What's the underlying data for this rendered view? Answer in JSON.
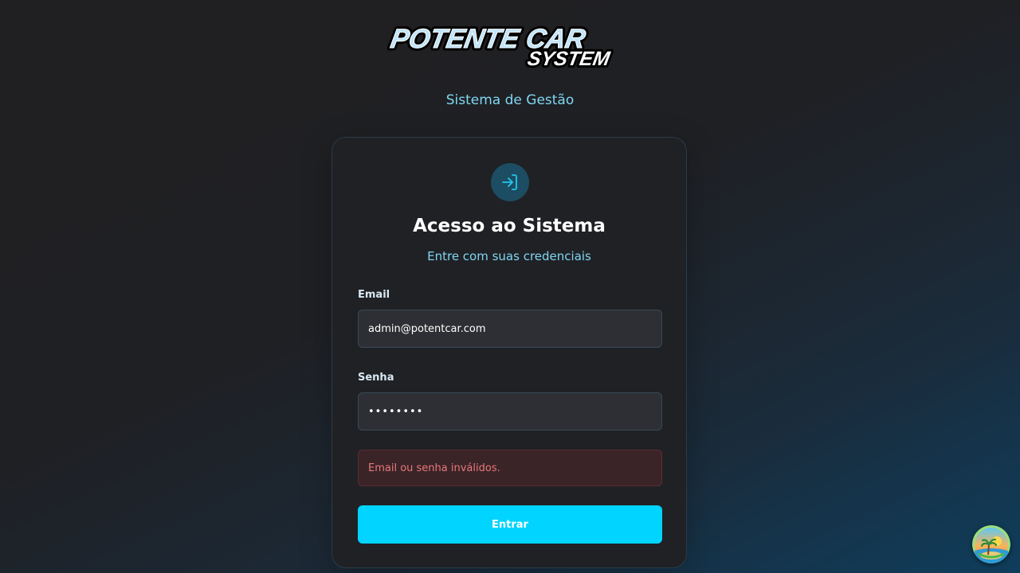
{
  "header": {
    "logo_line1": "POTENTE CAR",
    "logo_line2": "SYSTEM",
    "subtitle": "Sistema de Gestão"
  },
  "card": {
    "icon": "login-icon",
    "title": "Acesso ao Sistema",
    "subtitle": "Entre com suas credenciais"
  },
  "form": {
    "email_label": "Email",
    "email_value": "admin@potentcar.com",
    "password_label": "Senha",
    "password_value": "••••••••",
    "error_message": "Email ou senha inválidos.",
    "submit_label": "Entrar"
  },
  "colors": {
    "accent": "#00d4ff",
    "accent_text": "#7fd6f2",
    "error_text": "#e8787a",
    "error_bg": "#3a2428",
    "card_bg": "#202125"
  },
  "corner_widget": {
    "icon": "beach-avatar-icon"
  }
}
